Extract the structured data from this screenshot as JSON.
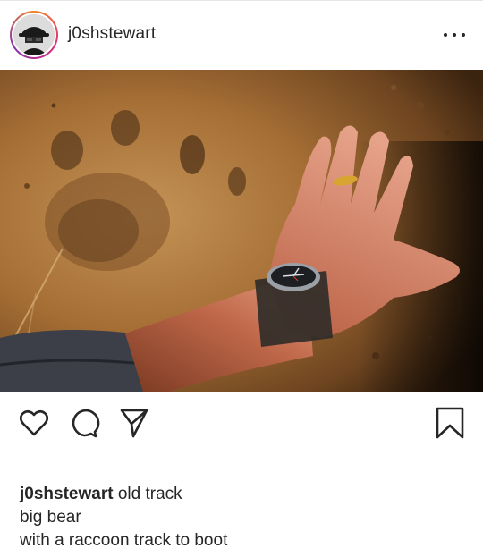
{
  "post": {
    "username": "j0shstewart",
    "more_icon": "more-horizontal-icon",
    "photo_alt": "hand beside bear track in dirt"
  },
  "actions": {
    "like_icon": "heart-icon",
    "comment_icon": "comment-icon",
    "share_icon": "send-icon",
    "save_icon": "bookmark-icon"
  },
  "caption": {
    "username": "j0shstewart",
    "first_line": "old track",
    "lines": [
      "big bear",
      "with a raccoon track to boot"
    ]
  },
  "colors": {
    "text": "#262626",
    "ring_start": "#f58529",
    "ring_mid": "#dd2a7b",
    "ring_end": "#8134af"
  }
}
